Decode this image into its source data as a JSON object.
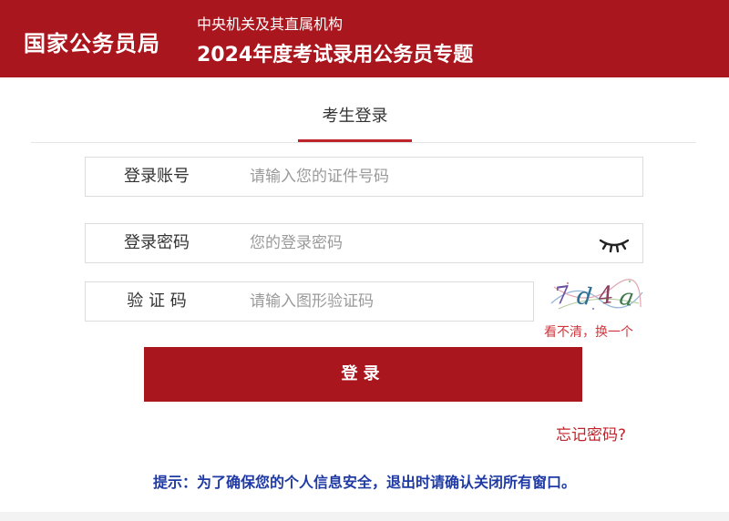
{
  "header": {
    "agency": "国家公务员局",
    "subtitle": "中央机关及其直属机构",
    "title": "2024年度考试录用公务员专题"
  },
  "tab": {
    "label": "考生登录"
  },
  "form": {
    "account_label": "登录账号",
    "account_placeholder": "请输入您的证件号码",
    "password_label": "登录密码",
    "password_placeholder": "您的登录密码",
    "captcha_label": "验 证 码",
    "captcha_placeholder": "请输入图形验证码",
    "captcha_refresh": "看不清，换一个",
    "captcha_text": "7d4a",
    "login_button": "登录",
    "forgot_password": "忘记密码?"
  },
  "tip": "提示：为了确保您的个人信息安全，退出时请确认关闭所有窗口。",
  "colors": {
    "brand_red": "#a9161d",
    "accent_red": "#c0242b",
    "tip_blue": "#1f3aa5"
  },
  "icons": {
    "password_toggle": "eye-closed-icon",
    "captcha": "captcha-image"
  }
}
